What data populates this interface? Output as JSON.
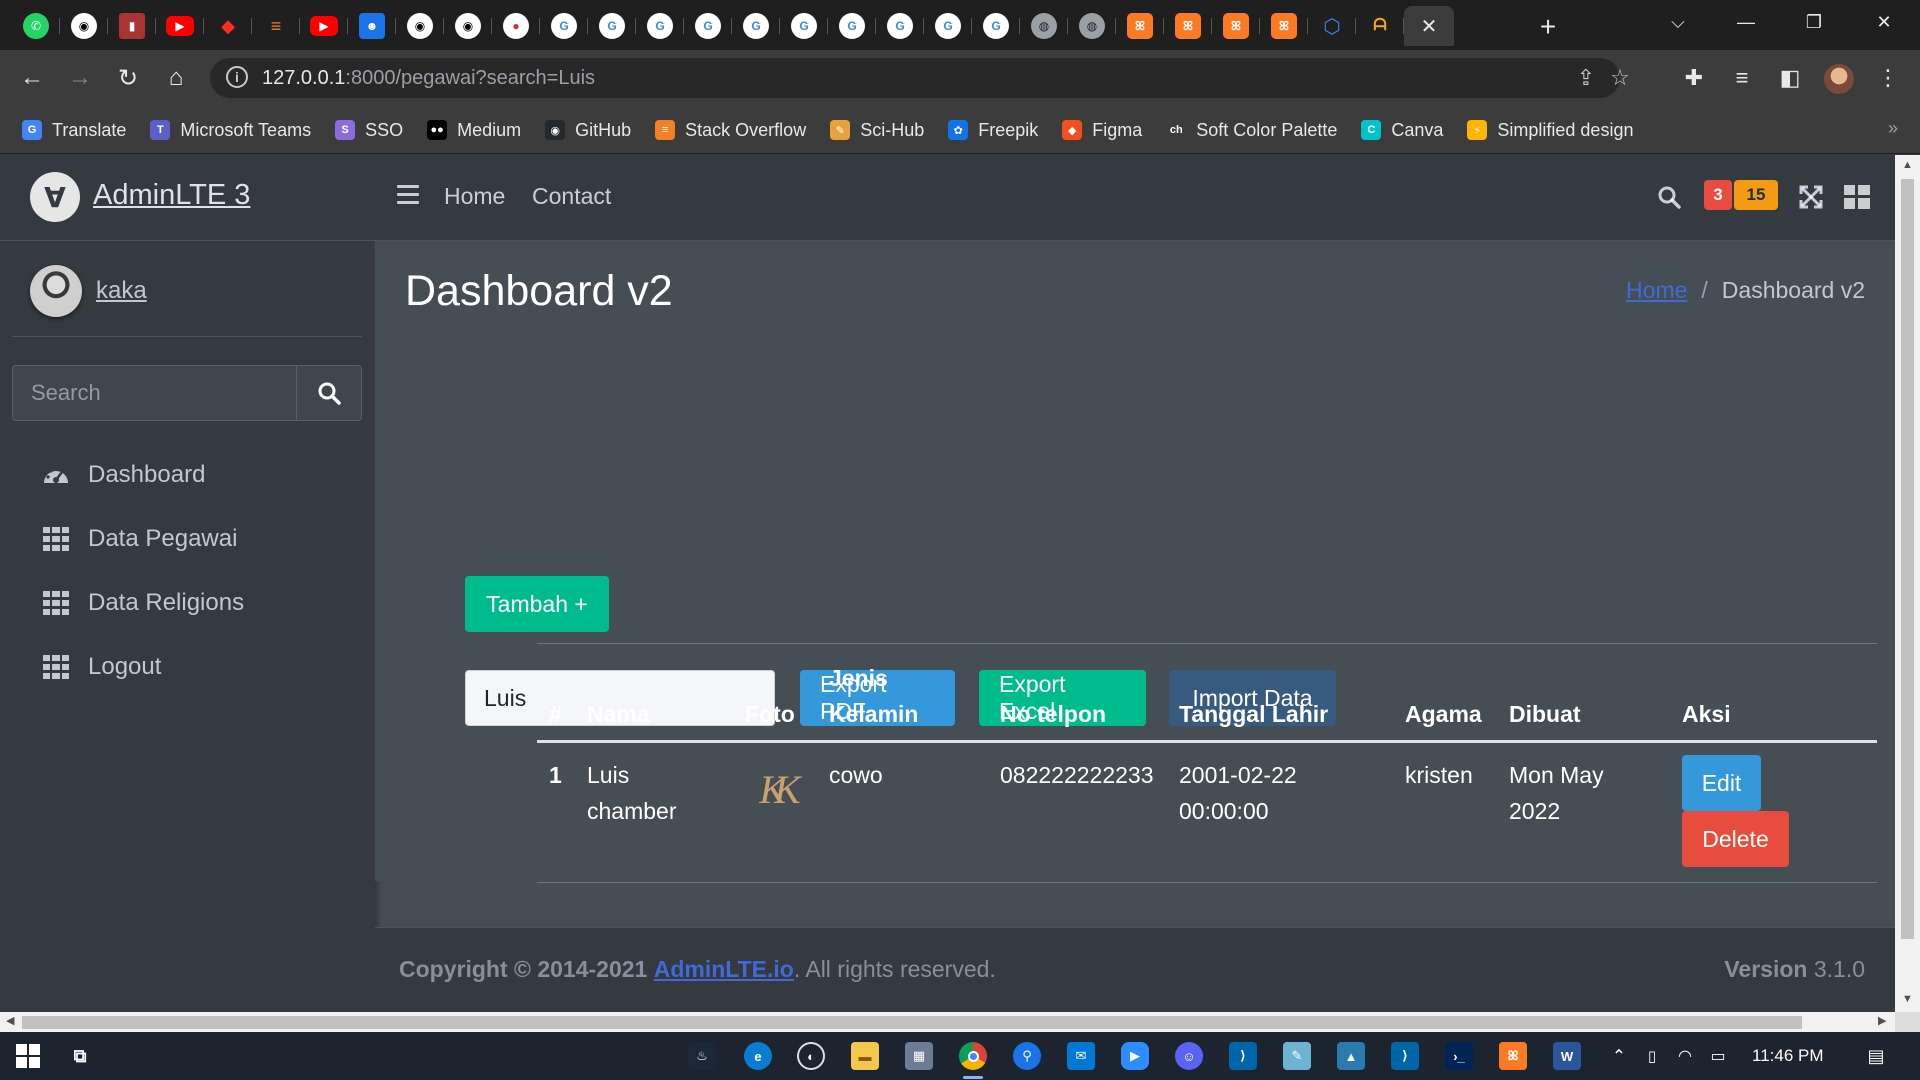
{
  "browser": {
    "url_host": "127.0.0.1",
    "url_path": ":8000/pegawai?search=Luis",
    "active_tab_close": "✕",
    "new_tab": "+",
    "bookmarks": [
      {
        "label": "Translate",
        "icon": "translate-icon",
        "color": "#4285f4"
      },
      {
        "label": "Microsoft Teams",
        "icon": "teams-icon",
        "color": "#5b5fc7"
      },
      {
        "label": "SSO",
        "icon": "sso-icon",
        "color": "#8e6bdc"
      },
      {
        "label": "Medium",
        "icon": "medium-icon",
        "color": "#000000"
      },
      {
        "label": "GitHub",
        "icon": "github-icon",
        "color": "#24292e"
      },
      {
        "label": "Stack Overflow",
        "icon": "stackoverflow-icon",
        "color": "#f48024"
      },
      {
        "label": "Sci-Hub",
        "icon": "scihub-icon",
        "color": "#e6a23c"
      },
      {
        "label": "Freepik",
        "icon": "freepik-icon",
        "color": "#1273eb"
      },
      {
        "label": "Figma",
        "icon": "figma-icon",
        "color": "#f24e1e"
      },
      {
        "label": "Soft Color Palette",
        "icon": "colorhunt-icon",
        "color": "#3c3c3c"
      },
      {
        "label": "Canva",
        "icon": "canva-icon",
        "color": "#00c4cc"
      },
      {
        "label": "Simplified design",
        "icon": "simplified-icon",
        "color": "#ffb400"
      }
    ]
  },
  "app": {
    "brand": "AdminLTE 3",
    "user": "kaka",
    "sidebar_search_placeholder": "Search",
    "nav": [
      {
        "label": "Dashboard",
        "icon": "dashboard-icon"
      },
      {
        "label": "Data Pegawai",
        "icon": "grid-icon"
      },
      {
        "label": "Data Religions",
        "icon": "grid-icon"
      },
      {
        "label": "Logout",
        "icon": "grid-icon"
      }
    ],
    "header": {
      "home": "Home",
      "contact": "Contact",
      "badge_messages": "3",
      "badge_notifications": "15"
    }
  },
  "content": {
    "title": "Dashboard v2",
    "breadcrumb_home": "Home",
    "breadcrumb_sep": "/",
    "breadcrumb_current": "Dashboard v2",
    "add_button": "Tambah +",
    "search_value": "Luis",
    "export_pdf": "Export PDF",
    "export_excel": "Export Excel",
    "import_data": "Import Data",
    "table": {
      "headers": [
        "#",
        "Nama",
        "Foto",
        "Jenis Kelamin",
        "No telpon",
        "Tanggal Lahir",
        "Agama",
        "Dibuat",
        "Aksi"
      ],
      "rows": [
        {
          "no": "1",
          "nama": "Luis chamber",
          "foto": "KK",
          "jenis_kelamin": "cowo",
          "no_telpon": "082222222233",
          "tanggal_lahir": "2001-02-22 00:00:00",
          "agama": "kristen",
          "dibuat": "Mon May 2022",
          "edit": "Edit",
          "delete": "Delete"
        }
      ]
    }
  },
  "footer": {
    "copyright_prefix": "Copyright © 2014-2021",
    "link": "AdminLTE.io",
    "copyright_suffix": ". All rights reserved.",
    "version_label": "Version",
    "version_value": "3.1.0"
  },
  "taskbar": {
    "clock": "11:46 PM"
  },
  "colors": {
    "accent_success": "#00bc8c",
    "accent_info": "#3498db",
    "accent_primary": "#375a7f",
    "accent_danger": "#e74c3c",
    "badge_danger": "#e74c3c",
    "badge_warning": "#f39c12"
  }
}
